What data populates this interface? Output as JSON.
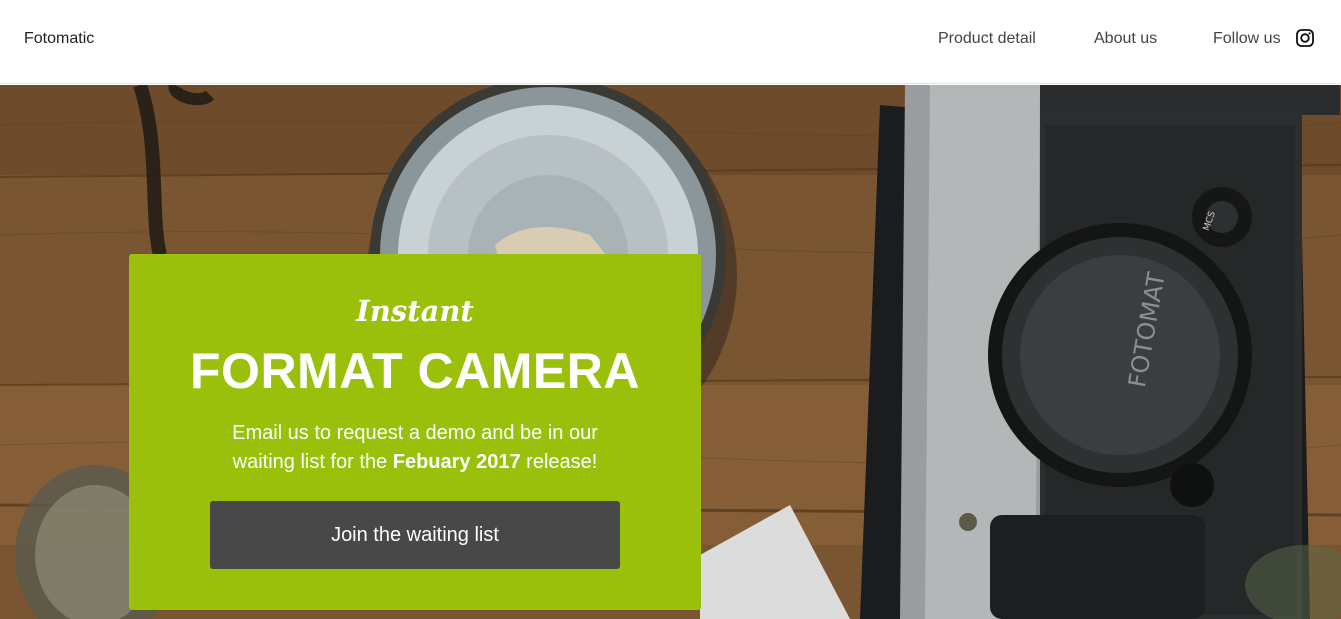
{
  "navbar": {
    "brand": "Fotomatic",
    "links": [
      "Product detail",
      "About us",
      "Follow us"
    ],
    "social_icon": "instagram-icon"
  },
  "hero": {
    "background_image": "overhead photo of a vintage camera and ceramic bowl on a wooden table",
    "camera_cap_text": "FOTOMAT",
    "dial_text": "MCS"
  },
  "card": {
    "script_title": "Instant",
    "title": "FORMAT CAMERA",
    "text_before": "Email us to request a demo and be in our waiting list for the ",
    "text_bold": "Febuary 2017",
    "text_after": " release!",
    "button_label": "Join the waiting list",
    "background_color": "#9ac00c",
    "button_color": "#484848"
  }
}
